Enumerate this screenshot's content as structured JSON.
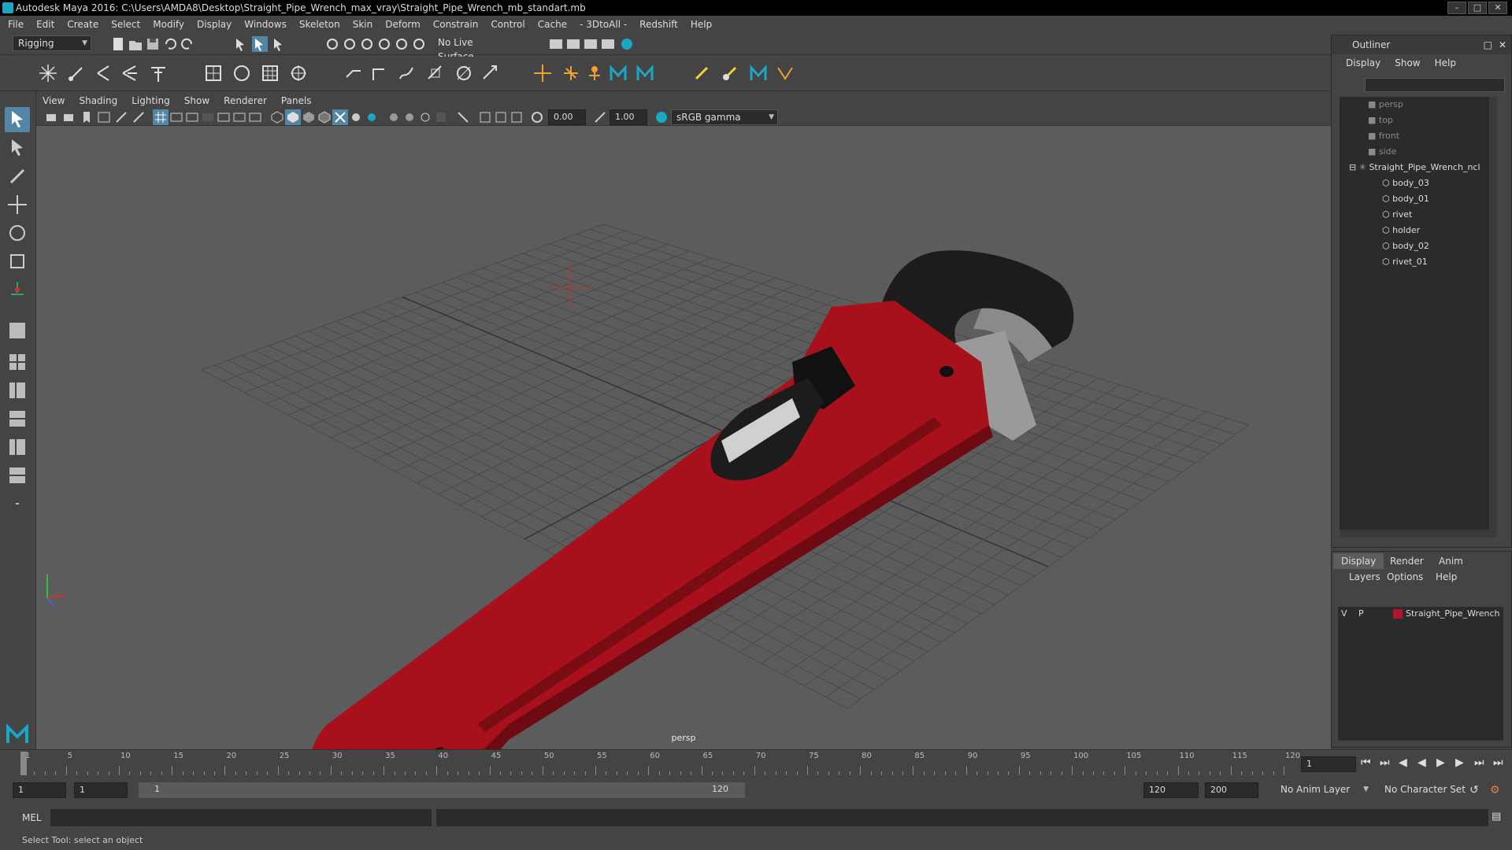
{
  "title_bar": {
    "text": "Autodesk Maya 2016: C:\\Users\\AMDA8\\Desktop\\Straight_Pipe_Wrench_max_vray\\Straight_Pipe_Wrench_mb_standart.mb"
  },
  "menubar": {
    "items": [
      "File",
      "Edit",
      "Create",
      "Select",
      "Modify",
      "Display",
      "Windows",
      "Skeleton",
      "Skin",
      "Deform",
      "Constrain",
      "Control",
      "Cache",
      "- 3DtoAll -",
      "Redshift",
      "Help"
    ]
  },
  "status_line": {
    "menuset": "Rigging",
    "live_surface": "No Live Surface"
  },
  "panel": {
    "menu": [
      "View",
      "Shading",
      "Lighting",
      "Show",
      "Renderer",
      "Panels"
    ],
    "exposure": "0.00",
    "gamma": "1.00",
    "colorspace": "sRGB gamma",
    "camera_label": "persp"
  },
  "outliner": {
    "title": "Outliner",
    "menu": [
      "Display",
      "Show",
      "Help"
    ],
    "items": [
      {
        "label": "persp",
        "dim": true
      },
      {
        "label": "top",
        "dim": true
      },
      {
        "label": "front",
        "dim": true
      },
      {
        "label": "side",
        "dim": true
      },
      {
        "label": "Straight_Pipe_Wrench_ncl",
        "dim": false
      },
      {
        "label": "body_03",
        "dim": false
      },
      {
        "label": "body_01",
        "dim": false
      },
      {
        "label": "rivet",
        "dim": false
      },
      {
        "label": "holder",
        "dim": false
      },
      {
        "label": "body_02",
        "dim": false
      },
      {
        "label": "rivet_01",
        "dim": false
      }
    ]
  },
  "layer_editor": {
    "tabs": [
      "Display",
      "Render",
      "Anim"
    ],
    "menu": [
      "Layers",
      "Options",
      "Help"
    ],
    "layer": {
      "v": "V",
      "p": "P",
      "name": "Straight_Pipe_Wrench",
      "color": "#b0162a"
    }
  },
  "time_slider": {
    "ticks": [
      "1",
      "5",
      "10",
      "15",
      "20",
      "25",
      "30",
      "35",
      "40",
      "45",
      "50",
      "55",
      "60",
      "65",
      "70",
      "75",
      "80",
      "85",
      "90",
      "95",
      "100",
      "105",
      "110",
      "115",
      "120"
    ],
    "current_frame": "1"
  },
  "range_slider": {
    "start": "1",
    "anim_start": "1",
    "range_left": "1",
    "range_right": "120",
    "end": "120",
    "anim_end": "200",
    "anim_layer": "No Anim Layer",
    "character_set": "No Character Set"
  },
  "command_line": {
    "label": "MEL"
  },
  "help_line": {
    "text": "Select Tool: select an object"
  },
  "colors": {
    "wrench_red": "#a8101c",
    "viewport_bg": "#5c5c5c",
    "maya_teal": "#1aa7c3"
  }
}
